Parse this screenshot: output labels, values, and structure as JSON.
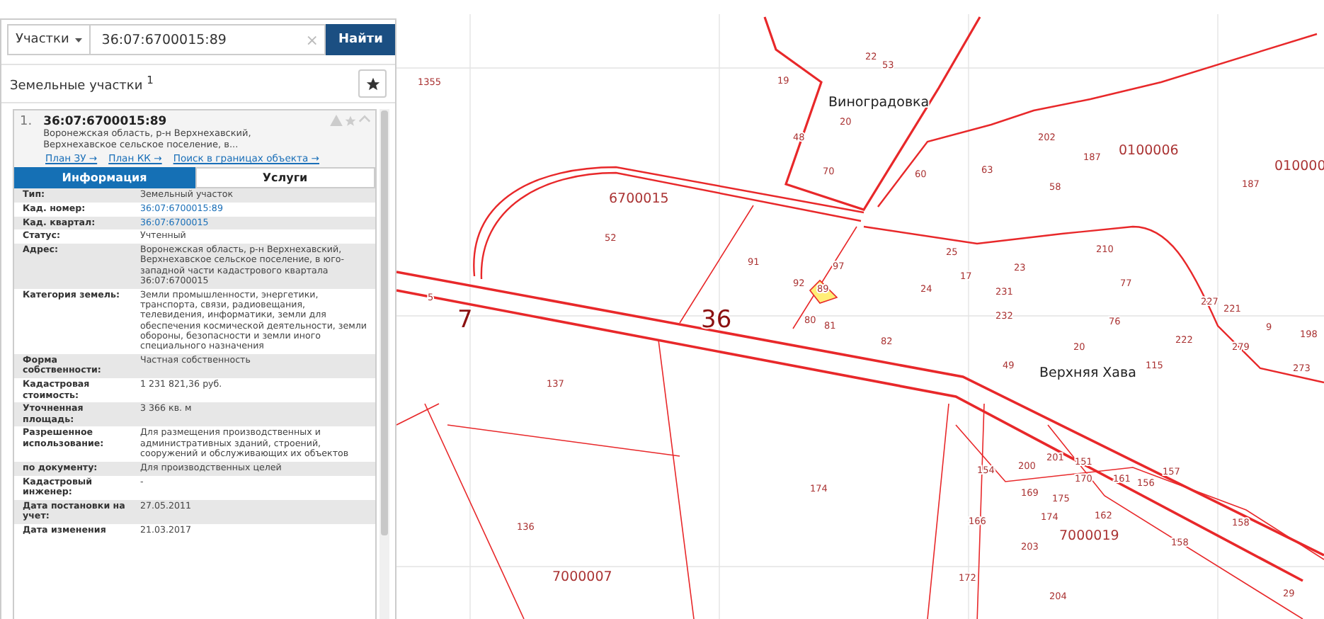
{
  "search": {
    "type_select": "Участки",
    "value": "36:07:6700015:89",
    "clear": "×",
    "button": "Найти"
  },
  "results_header": {
    "title": "Земельные участки $^{1}$"
  },
  "result": {
    "index": "1.",
    "cad_number": "36:07:6700015:89",
    "address": "Воронежская область, р-н Верхнехавский, Верхнехавское сельское поселение, в...",
    "links": [
      "План ЗУ →",
      "План КК →",
      "Поиск в границах объекта →"
    ],
    "tabs": [
      {
        "label": "Информация",
        "selected": true
      },
      {
        "label": "Услуги",
        "selected": false
      }
    ],
    "rows": [
      {
        "label": "Тип:",
        "value": "Земельный участок",
        "kind": "text"
      },
      {
        "label": "Кад. номер:",
        "value": "36:07:6700015:89",
        "kind": "link"
      },
      {
        "label": "Кад. квартал:",
        "value": "36:07:6700015",
        "kind": "link"
      },
      {
        "label": "Статус:",
        "value": "Учтенный",
        "kind": "text"
      },
      {
        "label": "Адрес:",
        "value": "Воронежская область, р-н Верхнехавский, Верхнехавское сельское поселение, в юго-западной части кадастрового квартала 36:07:6700015",
        "kind": "text"
      },
      {
        "label": "Категория земель:",
        "value": "Земли промышленности, энергетики, транспорта, связи, радиовещания, телевидения, информатики, земли для обеспечения космической деятельности, земли обороны, безопасности и земли иного специального назначения",
        "kind": "text"
      },
      {
        "label": "Форма собственности:",
        "value": "Частная собственность",
        "kind": "text"
      },
      {
        "label": "Кадастровая стоимость:",
        "value": "1 231 821,36 руб.",
        "kind": "text"
      },
      {
        "label": "Уточненная площадь:",
        "value": "3 366 кв. м",
        "kind": "text"
      },
      {
        "label": "Разрешенное использование:",
        "value": "Для размещения производственных и административных зданий, строений, сооружений и обслуживающих их объектов",
        "kind": "text"
      },
      {
        "label": "по документу:",
        "value": "Для производственных целей",
        "kind": "text"
      },
      {
        "label": "Кадастровый инженер:",
        "value": "-",
        "kind": "text"
      },
      {
        "label": "Дата постановки на учет:",
        "value": "27.05.2011",
        "kind": "text"
      },
      {
        "label": "Дата изменения",
        "value": "21.03.2017",
        "kind": "text"
      }
    ]
  },
  "map": {
    "labels": [
      {
        "text": "1355",
        "kind": "number"
      },
      {
        "text": "Виноградовка",
        "kind": "place"
      },
      {
        "text": "6700015",
        "kind": "quarter"
      },
      {
        "text": "52",
        "kind": "number"
      },
      {
        "text": "91",
        "kind": "number"
      },
      {
        "text": "7",
        "kind": "district"
      },
      {
        "text": "36",
        "kind": "district"
      },
      {
        "text": "5",
        "kind": "number"
      },
      {
        "text": "137",
        "kind": "number"
      },
      {
        "text": "136",
        "kind": "number"
      },
      {
        "text": "174",
        "kind": "number"
      },
      {
        "text": "7000007",
        "kind": "quarter"
      },
      {
        "text": "60",
        "kind": "number"
      },
      {
        "text": "63",
        "kind": "number"
      },
      {
        "text": "202",
        "kind": "number"
      },
      {
        "text": "187",
        "kind": "number"
      },
      {
        "text": "0100006",
        "kind": "quarter"
      },
      {
        "text": "187",
        "kind": "number"
      },
      {
        "text": "010000",
        "kind": "quarter"
      },
      {
        "text": "210",
        "kind": "number"
      },
      {
        "text": "25",
        "kind": "number"
      },
      {
        "text": "24",
        "kind": "number"
      },
      {
        "text": "17",
        "kind": "number"
      },
      {
        "text": "49",
        "kind": "number"
      },
      {
        "text": "20",
        "kind": "number"
      },
      {
        "text": "Верхняя Хава",
        "kind": "place"
      },
      {
        "text": "82",
        "kind": "number"
      },
      {
        "text": "80",
        "kind": "number"
      },
      {
        "text": "81",
        "kind": "number"
      },
      {
        "text": "92",
        "kind": "number"
      },
      {
        "text": "97",
        "kind": "number"
      },
      {
        "text": "89",
        "kind": "number"
      },
      {
        "text": "70",
        "kind": "number"
      },
      {
        "text": "48",
        "kind": "number"
      },
      {
        "text": "19",
        "kind": "number"
      },
      {
        "text": "22",
        "kind": "number"
      },
      {
        "text": "53",
        "kind": "number"
      },
      {
        "text": "20",
        "kind": "number"
      },
      {
        "text": "58",
        "kind": "number"
      },
      {
        "text": "23",
        "kind": "number"
      },
      {
        "text": "231",
        "kind": "number"
      },
      {
        "text": "232",
        "kind": "number"
      },
      {
        "text": "77",
        "kind": "number"
      },
      {
        "text": "76",
        "kind": "number"
      },
      {
        "text": "115",
        "kind": "number"
      },
      {
        "text": "222",
        "kind": "number"
      },
      {
        "text": "227",
        "kind": "number"
      },
      {
        "text": "221",
        "kind": "number"
      },
      {
        "text": "9",
        "kind": "number"
      },
      {
        "text": "279",
        "kind": "number"
      },
      {
        "text": "273",
        "kind": "number"
      },
      {
        "text": "198",
        "kind": "number"
      },
      {
        "text": "154",
        "kind": "number"
      },
      {
        "text": "200",
        "kind": "number"
      },
      {
        "text": "201",
        "kind": "number"
      },
      {
        "text": "151",
        "kind": "number"
      },
      {
        "text": "170",
        "kind": "number"
      },
      {
        "text": "161",
        "kind": "number"
      },
      {
        "text": "156",
        "kind": "number"
      },
      {
        "text": "157",
        "kind": "number"
      },
      {
        "text": "169",
        "kind": "number"
      },
      {
        "text": "175",
        "kind": "number"
      },
      {
        "text": "174",
        "kind": "number"
      },
      {
        "text": "162",
        "kind": "number"
      },
      {
        "text": "166",
        "kind": "number"
      },
      {
        "text": "7000019",
        "kind": "quarter"
      },
      {
        "text": "158",
        "kind": "number"
      },
      {
        "text": "158",
        "kind": "number"
      },
      {
        "text": "203",
        "kind": "number"
      },
      {
        "text": "172",
        "kind": "number"
      },
      {
        "text": "204",
        "kind": "number"
      },
      {
        "text": "29",
        "kind": "number"
      }
    ]
  }
}
